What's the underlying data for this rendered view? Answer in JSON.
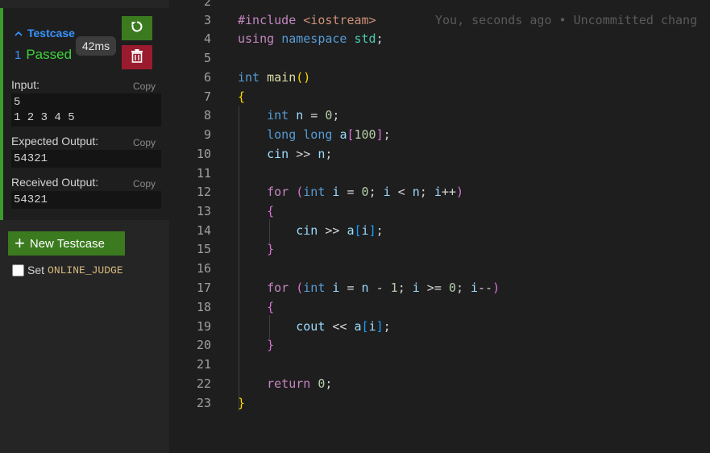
{
  "testcase": {
    "header": "Testcase",
    "index": "1",
    "status": "Passed",
    "time": "42ms",
    "input_label": "Input:",
    "input_value": "5\n1 2 3 4 5",
    "expected_label": "Expected Output:",
    "expected_value": "54321",
    "received_label": "Received Output:",
    "received_value": "54321",
    "copy_label": "Copy",
    "status_color": "#3cd33c",
    "accent_green": "#3b7a1f",
    "accent_red": "#9b1b2e",
    "icons": [
      "chevron-up-icon",
      "refresh-icon",
      "trash-icon",
      "plus-icon"
    ]
  },
  "actions": {
    "new_testcase": "New Testcase",
    "set_label": "Set",
    "oj_flag": "ONLINE_JUDGE"
  },
  "editor": {
    "blame": "You, seconds ago • Uncommitted chang",
    "line_numbers": [
      "2",
      "3",
      "4",
      "5",
      "6",
      "7",
      "8",
      "9",
      "10",
      "11",
      "12",
      "13",
      "14",
      "15",
      "16",
      "17",
      "18",
      "19",
      "20",
      "21",
      "22",
      "23"
    ]
  }
}
